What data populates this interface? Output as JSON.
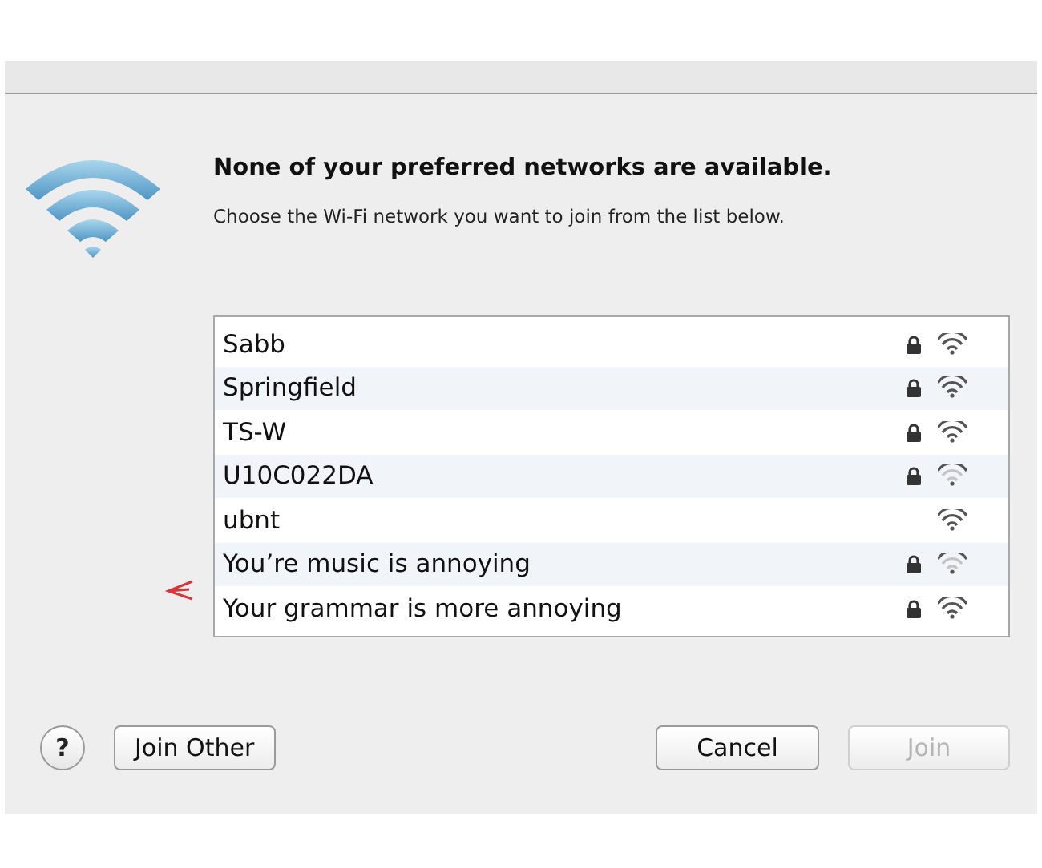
{
  "dialog": {
    "title": "None of your preferred networks are available.",
    "message": "Choose the Wi-Fi network you want to join from the list below."
  },
  "networks": [
    {
      "name": "Sabb",
      "locked": true,
      "weak_signal": false
    },
    {
      "name": "Springfield",
      "locked": true,
      "weak_signal": false
    },
    {
      "name": "TS-W",
      "locked": true,
      "weak_signal": false
    },
    {
      "name": "U10C022DA",
      "locked": true,
      "weak_signal": true
    },
    {
      "name": "ubnt",
      "locked": false,
      "weak_signal": false
    },
    {
      "name": "You’re music is annoying",
      "locked": true,
      "weak_signal": true
    },
    {
      "name": "Your grammar is more annoying",
      "locked": true,
      "weak_signal": false
    }
  ],
  "buttons": {
    "help": "?",
    "join_other": "Join Other",
    "cancel": "Cancel",
    "join": {
      "label": "Join",
      "disabled": true
    }
  }
}
